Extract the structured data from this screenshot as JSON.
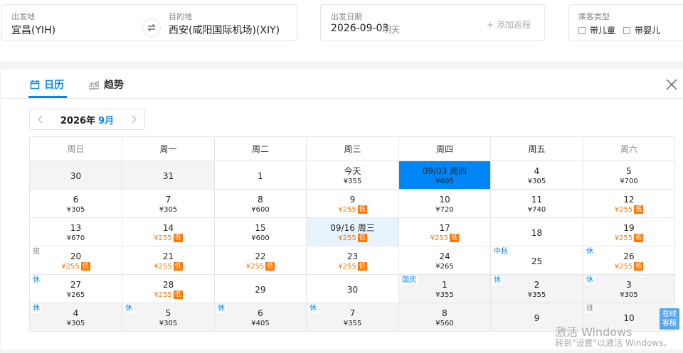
{
  "search": {
    "from_label": "出发地",
    "from_value": "宜昌(YIH)",
    "to_label": "目的地",
    "to_value": "西安(咸阳国际机场)(XIY)",
    "date_label": "出发日期",
    "date_value": "2026-09-03",
    "date_hint": "明天",
    "add_return": "+ 添加返程",
    "type_label": "乘客类型",
    "child": "带儿童",
    "infant": "带婴儿"
  },
  "tabs": {
    "calendar": "日历",
    "trend": "趋势"
  },
  "month_nav": {
    "year": "2026年",
    "month": "9月"
  },
  "weekdays": [
    "周日",
    "周一",
    "周二",
    "周三",
    "周四",
    "周五",
    "周六"
  ],
  "weeks": [
    [
      {
        "day": "30",
        "price": "",
        "state": "other"
      },
      {
        "day": "31",
        "price": "",
        "state": "other"
      },
      {
        "day": "1",
        "price": ""
      },
      {
        "day": "今天",
        "price": "¥355"
      },
      {
        "day": "09/03 周四",
        "price": "¥605",
        "state": "sel"
      },
      {
        "day": "4",
        "price": "¥305"
      },
      {
        "day": "5",
        "price": "¥700"
      }
    ],
    [
      {
        "day": "6",
        "price": "¥305"
      },
      {
        "day": "7",
        "price": "¥305"
      },
      {
        "day": "8",
        "price": "¥600"
      },
      {
        "day": "9",
        "price": "¥255",
        "low": true
      },
      {
        "day": "10",
        "price": "¥720"
      },
      {
        "day": "11",
        "price": "¥740"
      },
      {
        "day": "12",
        "price": "¥255",
        "low": true
      }
    ],
    [
      {
        "day": "13",
        "price": "¥670"
      },
      {
        "day": "14",
        "price": "¥255",
        "low": true
      },
      {
        "day": "15",
        "price": "¥600"
      },
      {
        "day": "09/16 周三",
        "price": "¥255",
        "low": true,
        "state": "hl"
      },
      {
        "day": "17",
        "price": "¥255",
        "low": true
      },
      {
        "day": "18",
        "price": ""
      },
      {
        "day": "19",
        "price": "¥255",
        "low": true
      }
    ],
    [
      {
        "day": "20",
        "price": "¥255",
        "low": true,
        "tag": "班",
        "tagtype": "ban"
      },
      {
        "day": "21",
        "price": "¥255",
        "low": true
      },
      {
        "day": "22",
        "price": "¥255",
        "low": true
      },
      {
        "day": "23",
        "price": "¥255",
        "low": true
      },
      {
        "day": "24",
        "price": "¥265"
      },
      {
        "day": "25",
        "price": "",
        "tag": "中秋"
      },
      {
        "day": "26",
        "price": "¥255",
        "low": true,
        "tag": "休"
      }
    ],
    [
      {
        "day": "27",
        "price": "¥265",
        "tag": "休"
      },
      {
        "day": "28",
        "price": "¥255",
        "low": true
      },
      {
        "day": "29",
        "price": ""
      },
      {
        "day": "30",
        "price": ""
      },
      {
        "day": "1",
        "price": "¥355",
        "state": "other",
        "tag": "国庆"
      },
      {
        "day": "2",
        "price": "¥355",
        "state": "other",
        "tag": "休"
      },
      {
        "day": "3",
        "price": "¥305",
        "state": "other",
        "tag": "休"
      }
    ],
    [
      {
        "day": "4",
        "price": "¥305",
        "state": "other",
        "tag": "休"
      },
      {
        "day": "5",
        "price": "¥305",
        "state": "other",
        "tag": "休"
      },
      {
        "day": "6",
        "price": "¥405",
        "state": "other",
        "tag": "休"
      },
      {
        "day": "7",
        "price": "¥355",
        "state": "other",
        "tag": "休"
      },
      {
        "day": "8",
        "price": "¥560",
        "state": "other"
      },
      {
        "day": "9",
        "price": "",
        "state": "other"
      },
      {
        "day": "10",
        "price": "",
        "state": "other",
        "tag": "班",
        "tagtype": "ban"
      }
    ]
  ],
  "low_label": "低",
  "chat": "在线客服",
  "watermark": {
    "line1": "激活 Windows",
    "line2": "转到\"设置\"以激活 Windows。"
  }
}
